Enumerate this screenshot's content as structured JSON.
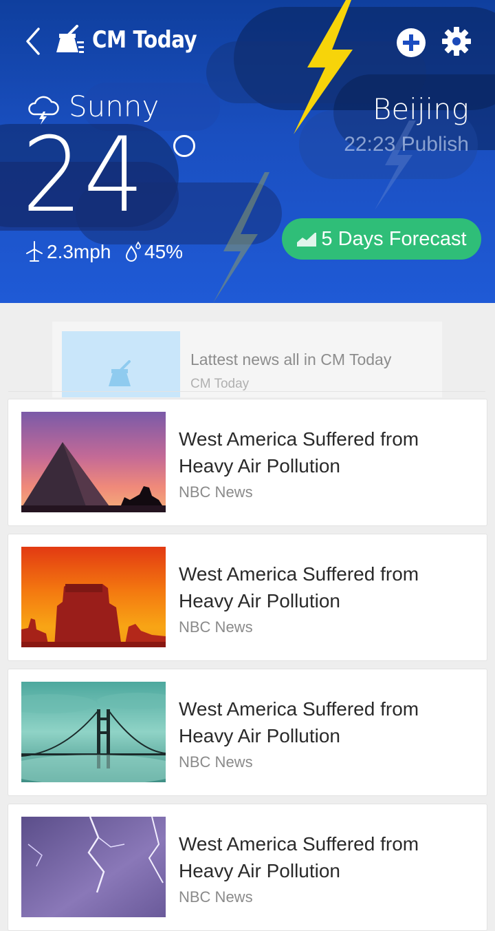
{
  "app": {
    "title": "CM Today"
  },
  "weather": {
    "condition": "Sunny",
    "temperature": "24",
    "wind": "2.3mph",
    "humidity": "45%",
    "city": "Beijing",
    "publish_time": "22:23 Publish",
    "forecast_button": "5 Days Forecast"
  },
  "promo": {
    "title": "Lattest news all in CM Today",
    "source": "CM Today"
  },
  "news": [
    {
      "title": "West America Suffered from Heavy Air Pollution",
      "source": "NBC News",
      "image": "pyramid-sunset"
    },
    {
      "title": "West America Suffered from Heavy Air Pollution",
      "source": "NBC News",
      "image": "red-rock-butte"
    },
    {
      "title": "West America Suffered from Heavy Air Pollution",
      "source": "NBC News",
      "image": "bridge-in-fog"
    },
    {
      "title": "West America Suffered from Heavy Air Pollution",
      "source": "NBC News",
      "image": "lightning-sky"
    }
  ],
  "colors": {
    "header": "#1a4fc0",
    "accent_green": "#2fbe78",
    "bolt": "#f5d20f"
  }
}
